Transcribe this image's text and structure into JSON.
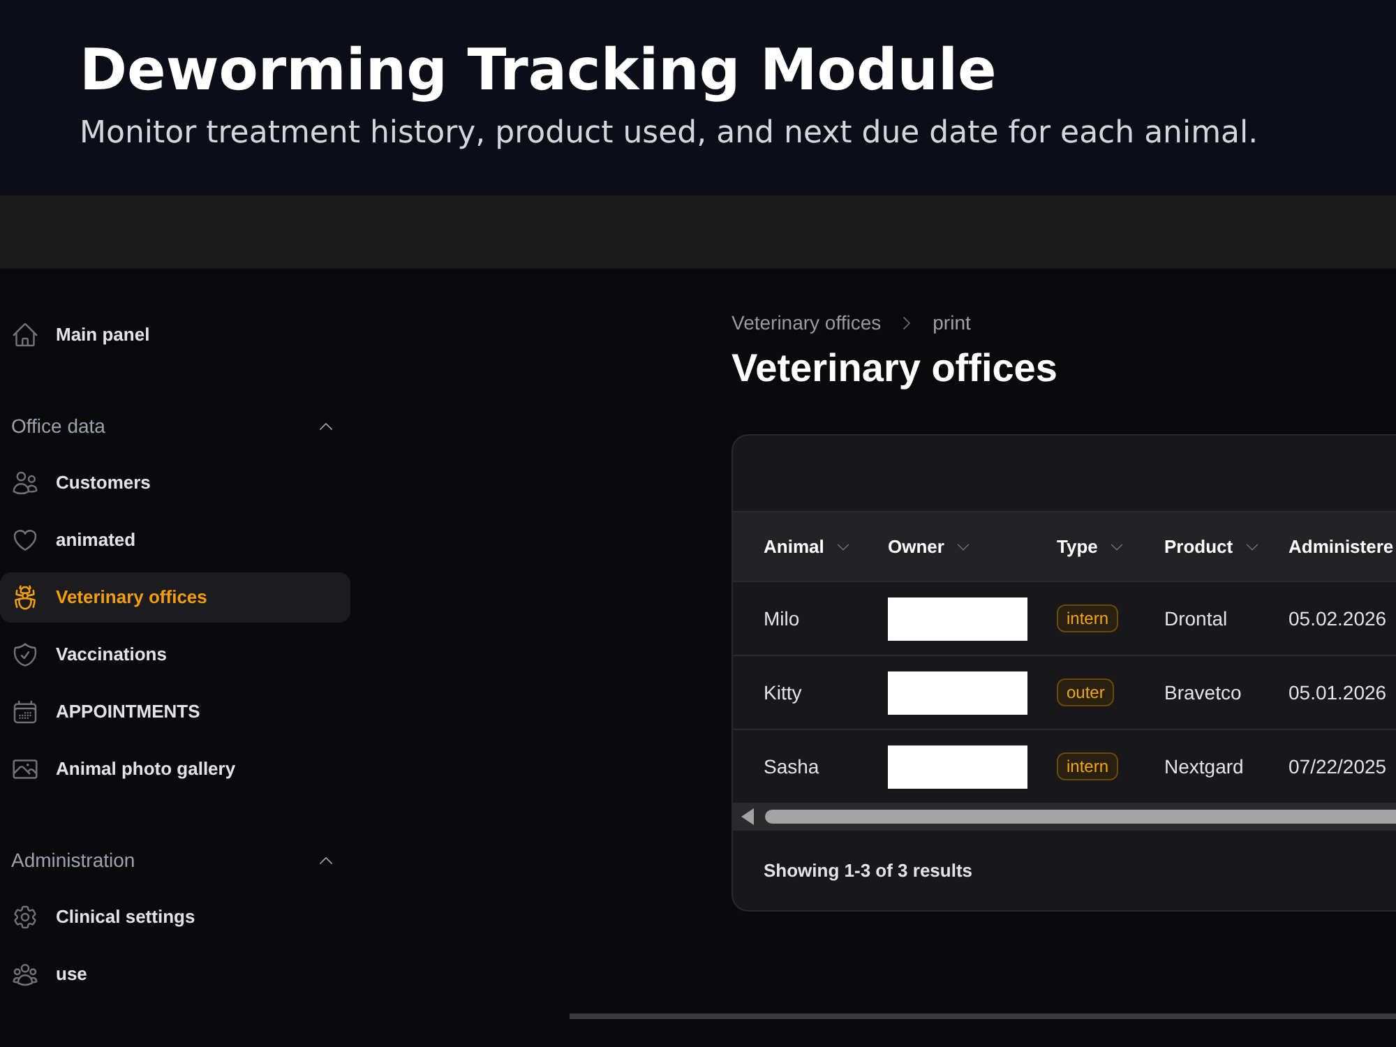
{
  "header": {
    "title": "Deworming Tracking Module",
    "subtitle": "Monitor treatment history, product used, and next due date for each animal."
  },
  "sidebar": {
    "sections": [
      {
        "items": [
          {
            "label": "Main panel",
            "selected": false
          }
        ]
      },
      {
        "label": "Office data",
        "expanded": true,
        "items": [
          {
            "label": "Customers",
            "selected": false
          },
          {
            "label": "animated",
            "selected": false
          },
          {
            "label": "Veterinary offices",
            "selected": true
          },
          {
            "label": "Vaccinations",
            "selected": false
          },
          {
            "label": "APPOINTMENTS",
            "selected": false
          },
          {
            "label": "Animal photo gallery",
            "selected": false
          }
        ]
      },
      {
        "label": "Administration",
        "expanded": true,
        "items": [
          {
            "label": "Clinical settings",
            "selected": false
          },
          {
            "label": "use",
            "selected": false
          }
        ]
      }
    ]
  },
  "breadcrumb": [
    "Veterinary offices",
    "print"
  ],
  "page_title": "Veterinary offices",
  "table": {
    "columns": [
      {
        "label": "Animal",
        "sort_indicator": true
      },
      {
        "label": "Owner",
        "sort_indicator": true
      },
      {
        "label": "Type",
        "sort_indicator": true
      },
      {
        "label": "Product",
        "sort_indicator": true
      },
      {
        "label": "Administere",
        "sort_indicator": false
      }
    ],
    "rows": [
      {
        "cells": [
          {
            "kind": "text",
            "text": "Milo"
          },
          {
            "kind": "redacted"
          },
          {
            "kind": "badge",
            "text": "intern"
          },
          {
            "kind": "text",
            "text": "Drontal"
          },
          {
            "kind": "text",
            "text": "05.02.2026"
          }
        ]
      },
      {
        "cells": [
          {
            "kind": "text",
            "text": "Kitty"
          },
          {
            "kind": "redacted"
          },
          {
            "kind": "badge",
            "text": "outer"
          },
          {
            "kind": "text",
            "text": "Bravetco"
          },
          {
            "kind": "text",
            "text": "05.01.2026"
          }
        ]
      },
      {
        "cells": [
          {
            "kind": "text",
            "text": "Sasha"
          },
          {
            "kind": "redacted"
          },
          {
            "kind": "badge",
            "text": "intern"
          },
          {
            "kind": "text",
            "text": "Nextgard"
          },
          {
            "kind": "text",
            "text": "07/22/2025"
          }
        ]
      }
    ],
    "footer": "Showing 1-3 of 3 results"
  }
}
